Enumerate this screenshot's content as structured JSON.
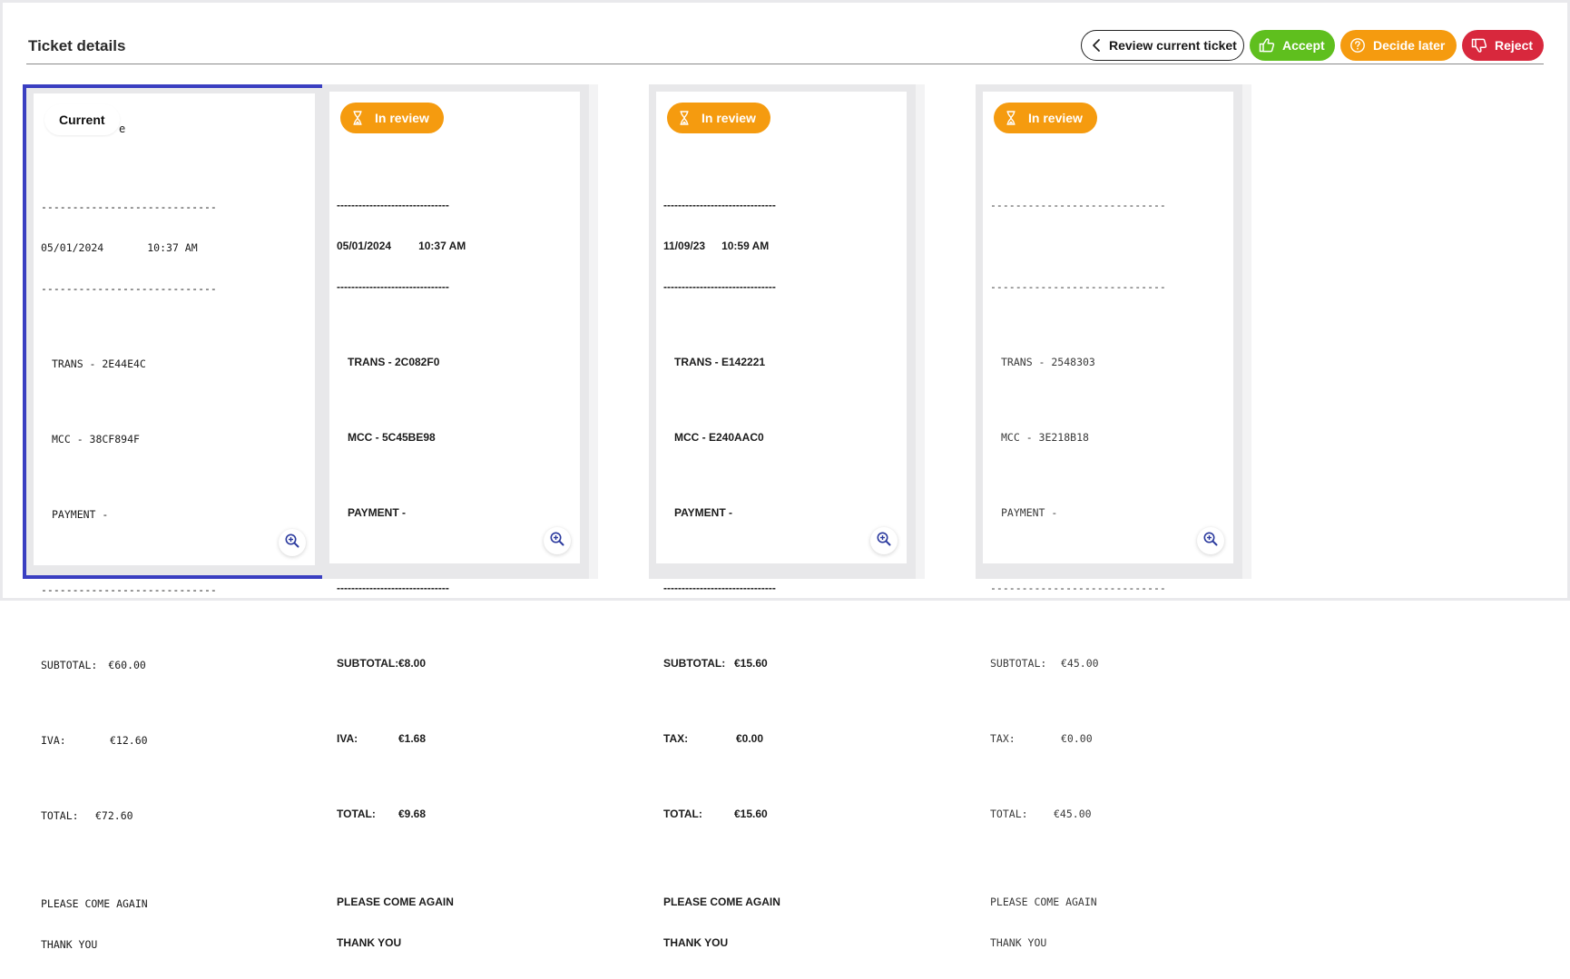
{
  "header": {
    "title": "Ticket details",
    "actions": {
      "review_label": "Review current ticket",
      "accept_label": "Accept",
      "later_label": "Decide later",
      "reject_label": "Reject"
    }
  },
  "colors": {
    "accent_border": "#3a3fc1",
    "accept": "#5fbf1e",
    "later": "#f59b0f",
    "reject": "#d8283d"
  },
  "tickets": [
    {
      "badge": "Current",
      "peek": "e",
      "sep": "----------------------------",
      "date": "05/01/2024",
      "time": "10:37 AM",
      "trans": "TRANS - 2E44E4C",
      "mcc": "MCC - 38CF894F",
      "payment": "PAYMENT -",
      "subtotal_label": "SUBTOTAL:",
      "subtotal": "€60.00",
      "tax_label": "IVA:",
      "tax": "€12.60",
      "total_label": "TOTAL:",
      "total": "€72.60",
      "footer1": "PLEASE COME AGAIN",
      "footer2": "THANK YOU"
    },
    {
      "badge": "In review",
      "sep": "-------------------------------",
      "date": "05/01/2024",
      "time": "10:37 AM",
      "trans": "TRANS - 2C082F0",
      "mcc": "MCC - 5C45BE98",
      "payment": "PAYMENT -",
      "subtotal_label": "SUBTOTAL:",
      "subtotal": "€8.00",
      "tax_label": "IVA:",
      "tax": "€1.68",
      "total_label": "TOTAL:",
      "total": "€9.68",
      "footer1": "PLEASE COME AGAIN",
      "footer2": "THANK YOU"
    },
    {
      "badge": "In review",
      "sep": "-------------------------------",
      "date": "11/09/23",
      "time": "10:59 AM",
      "trans": "TRANS - E142221",
      "mcc": "MCC - E240AAC0",
      "payment": "PAYMENT -",
      "subtotal_label": "SUBTOTAL:",
      "subtotal": "€15.60",
      "tax_label": "TAX:",
      "tax": "€0.00",
      "total_label": "TOTAL:",
      "total": "€15.60",
      "footer1": "PLEASE COME AGAIN",
      "footer2": "THANK YOU"
    },
    {
      "badge": "In review",
      "sep": "----------------------------",
      "date": "",
      "time": "",
      "trans": "TRANS - 2548303",
      "mcc": "MCC - 3E218B18",
      "payment": "PAYMENT -",
      "subtotal_label": "SUBTOTAL:",
      "subtotal": "€45.00",
      "tax_label": "TAX:",
      "tax": "€0.00",
      "total_label": "TOTAL:",
      "total": "€45.00",
      "footer1": "PLEASE COME AGAIN",
      "footer2": "THANK YOU"
    }
  ]
}
